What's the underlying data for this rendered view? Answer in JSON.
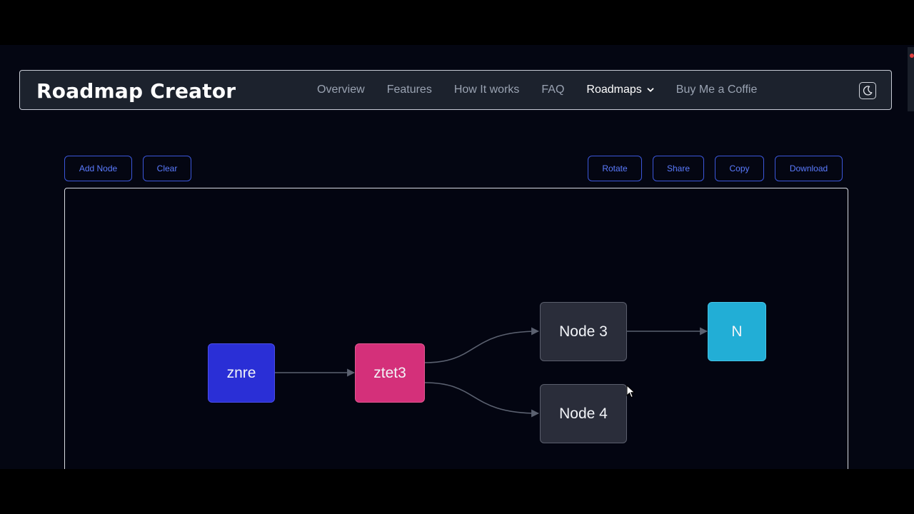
{
  "header": {
    "brand": "Roadmap Creator",
    "nav": [
      {
        "label": "Overview"
      },
      {
        "label": "Features"
      },
      {
        "label": "How It works"
      },
      {
        "label": "FAQ"
      },
      {
        "label": "Roadmaps",
        "active": true,
        "dropdown": true
      },
      {
        "label": "Buy Me a Coffie"
      }
    ],
    "theme_toggle_icon": "moon-icon"
  },
  "toolbar": {
    "add_node": "Add Node",
    "clear": "Clear",
    "rotate": "Rotate",
    "share": "Share",
    "copy": "Copy",
    "download": "Download"
  },
  "graph": {
    "nodes": [
      {
        "id": "n1",
        "label": "znre",
        "color": "#2a2fd6"
      },
      {
        "id": "n2",
        "label": "ztet3",
        "color": "#d4307a"
      },
      {
        "id": "n3",
        "label": "Node 3",
        "color": "#2a2d3a"
      },
      {
        "id": "n4",
        "label": "Node 4",
        "color": "#2a2d3a"
      },
      {
        "id": "n5",
        "label": "N",
        "color": "#22aed6"
      }
    ],
    "edges": [
      {
        "from": "n1",
        "to": "n2"
      },
      {
        "from": "n2",
        "to": "n3"
      },
      {
        "from": "n2",
        "to": "n4"
      },
      {
        "from": "n3",
        "to": "n5"
      }
    ]
  },
  "colors": {
    "accent": "#3b56d9",
    "edge": "#5b6170"
  }
}
